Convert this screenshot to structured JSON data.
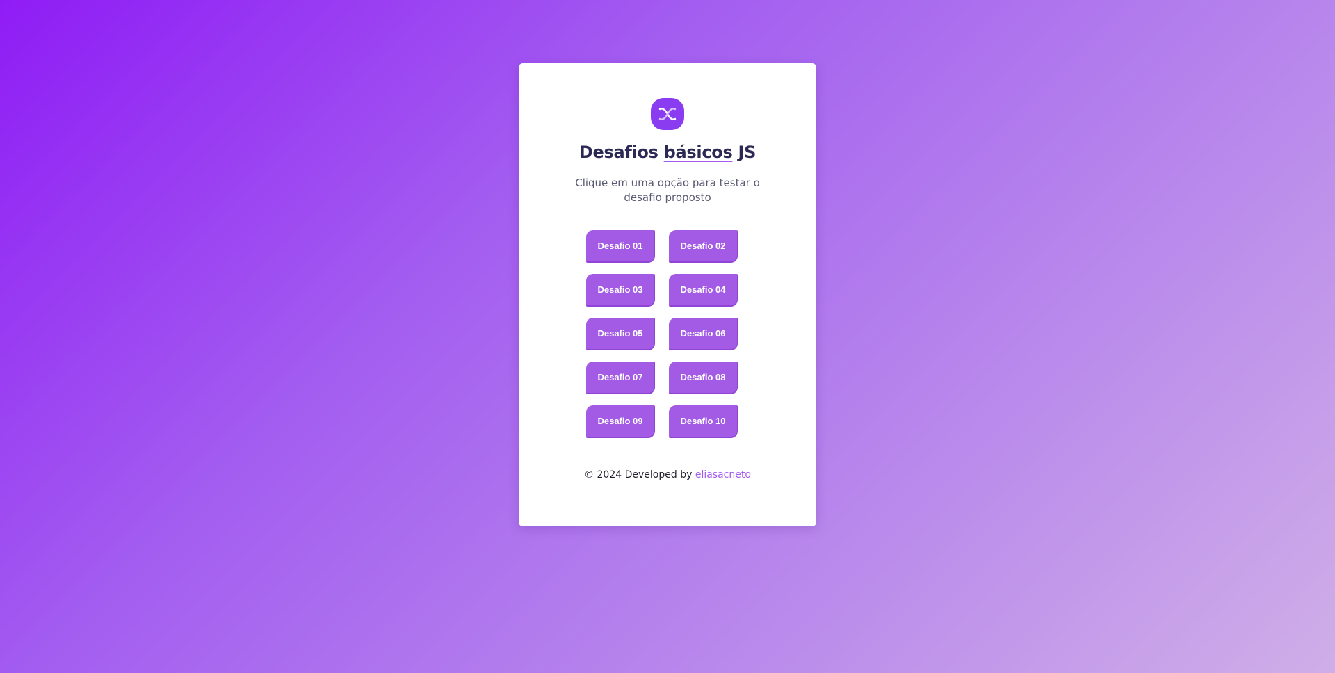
{
  "logo": {
    "icon": "js-logo-icon",
    "color": "#8a3df0"
  },
  "header": {
    "title_before": "Desafios ",
    "title_highlight": "básicos",
    "title_after": " JS",
    "subtitle": "Clique em uma opção para testar o desafio proposto"
  },
  "challenges": [
    {
      "label": "Desafio 01"
    },
    {
      "label": "Desafio 02"
    },
    {
      "label": "Desafio 03"
    },
    {
      "label": "Desafio 04"
    },
    {
      "label": "Desafio 05"
    },
    {
      "label": "Desafio 06"
    },
    {
      "label": "Desafio 07"
    },
    {
      "label": "Desafio 08"
    },
    {
      "label": "Desafio 09"
    },
    {
      "label": "Desafio 10"
    }
  ],
  "footer": {
    "text": "© 2024 Developed by ",
    "author": "eliasacneto"
  },
  "colors": {
    "accent": "#a35be6",
    "title": "#2c2a55",
    "link": "#a35df0"
  }
}
